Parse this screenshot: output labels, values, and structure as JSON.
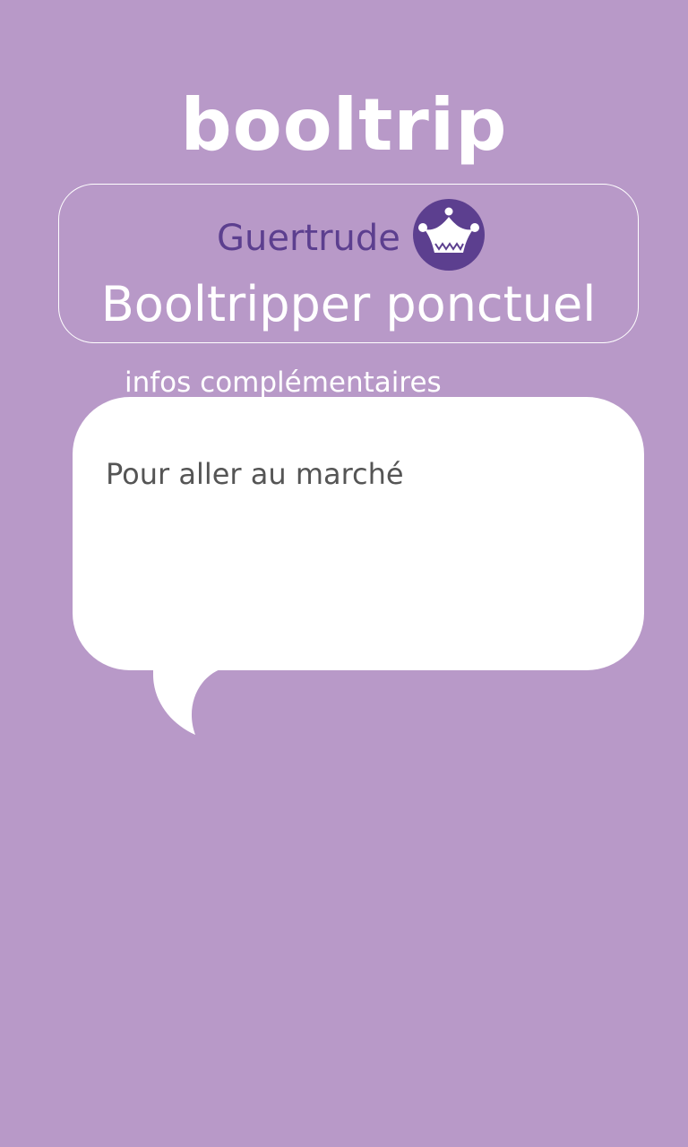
{
  "app": {
    "logo_text": "booltrip"
  },
  "profile": {
    "name": "Guertrude",
    "avatar_icon": "jester-hat-icon",
    "status": "Booltripper ponctuel"
  },
  "info": {
    "section_label": "infos complémentaires",
    "message": "Pour aller au marché"
  },
  "colors": {
    "background": "#b899c8",
    "accent": "#5c3f8f",
    "text_light": "#ffffff",
    "text_dark": "#555555"
  }
}
